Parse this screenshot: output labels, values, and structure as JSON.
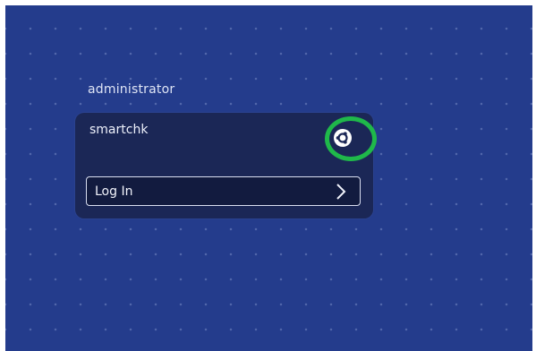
{
  "login_screen": {
    "other_user_label": "administrator",
    "selected_user": {
      "username": "smartchk"
    },
    "login_button_label": "Log In",
    "session_icon": "ubuntu-session-icon",
    "chevron_icon": "chevron-right-icon",
    "highlight_color": "#1fb84a"
  },
  "colors": {
    "background": "#243c8c",
    "panel": "#1b2756",
    "button_fill": "#121b3f",
    "text": "#eef1fb"
  }
}
